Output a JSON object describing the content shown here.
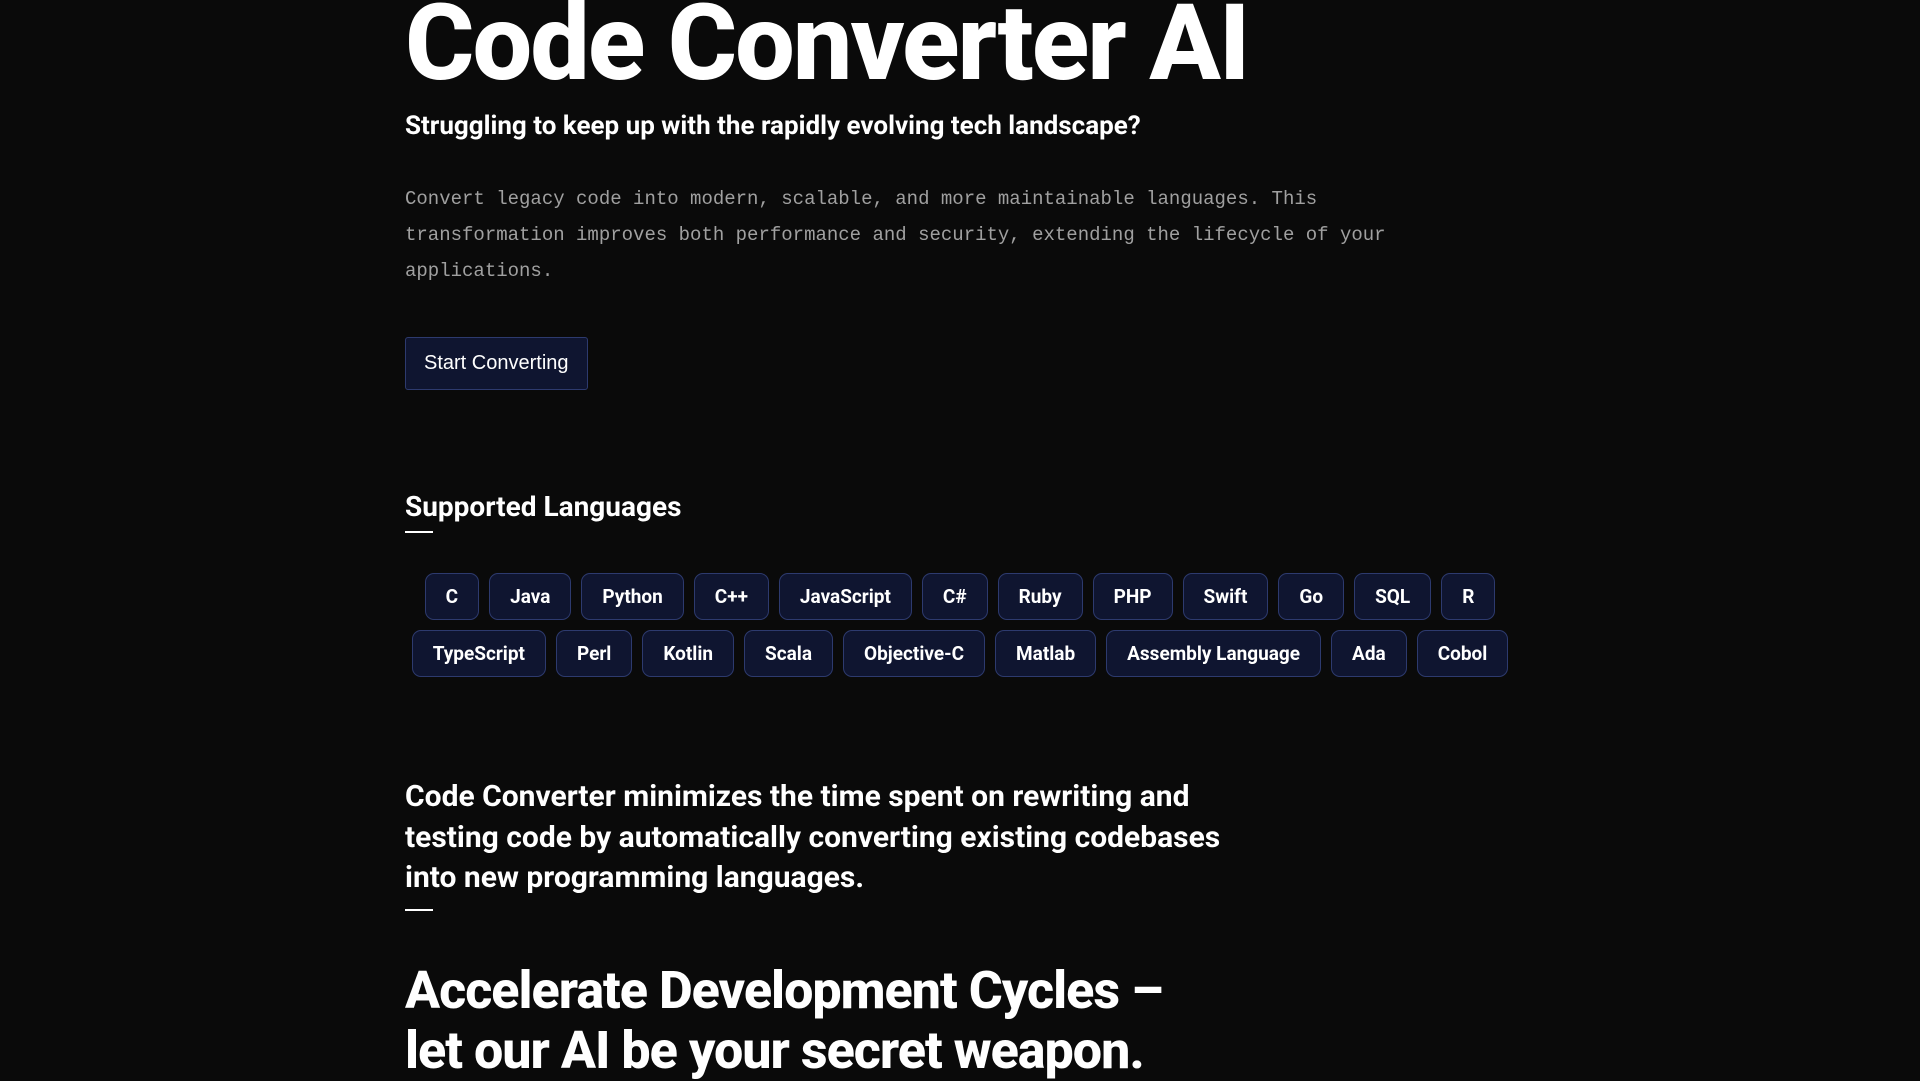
{
  "hero": {
    "title": "Code Converter AI",
    "subtitle": "Struggling to keep up with the rapidly evolving tech landscape?",
    "description": "Convert legacy code into modern, scalable, and more maintainable languages. This transformation improves both performance and security, extending the lifecycle of your applications.",
    "cta_label": "Start Converting"
  },
  "languages": {
    "heading": "Supported Languages",
    "items": [
      "C",
      "Java",
      "Python",
      "C++",
      "JavaScript",
      "C#",
      "Ruby",
      "PHP",
      "Swift",
      "Go",
      "SQL",
      "R",
      "TypeScript",
      "Perl",
      "Kotlin",
      "Scala",
      "Objective-C",
      "Matlab",
      "Assembly Language",
      "Ada",
      "Cobol"
    ]
  },
  "benefit": {
    "text": "Code Converter minimizes the time spent on rewriting and testing code by automatically converting existing codebases into new programming languages."
  },
  "accelerate": {
    "title": "Accelerate Development Cycles – let our AI be your secret weapon."
  }
}
